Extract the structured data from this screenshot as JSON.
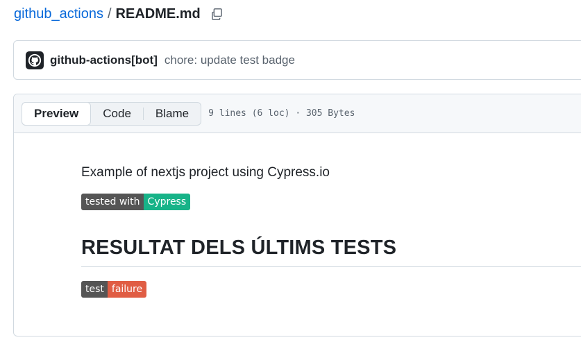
{
  "breadcrumb": {
    "repo": "github_actions",
    "separator": "/",
    "file": "README.md"
  },
  "commit": {
    "author": "github-actions[bot]",
    "message": "chore: update test badge"
  },
  "file_header": {
    "tabs": [
      "Preview",
      "Code",
      "Blame"
    ],
    "active_tab": "Preview",
    "meta": "9 lines (6 loc) · 305 Bytes"
  },
  "readme": {
    "intro": "Example of nextjs project using Cypress.io",
    "badge_tested": {
      "left": "tested with",
      "right": "Cypress",
      "color": "#17b388"
    },
    "heading": "RESULTAT DELS ÚLTIMS TESTS",
    "badge_test": {
      "left": "test",
      "right": "failure",
      "color": "#e05d44"
    }
  },
  "colors": {
    "link": "#0969da",
    "border": "#d1d9e0"
  }
}
